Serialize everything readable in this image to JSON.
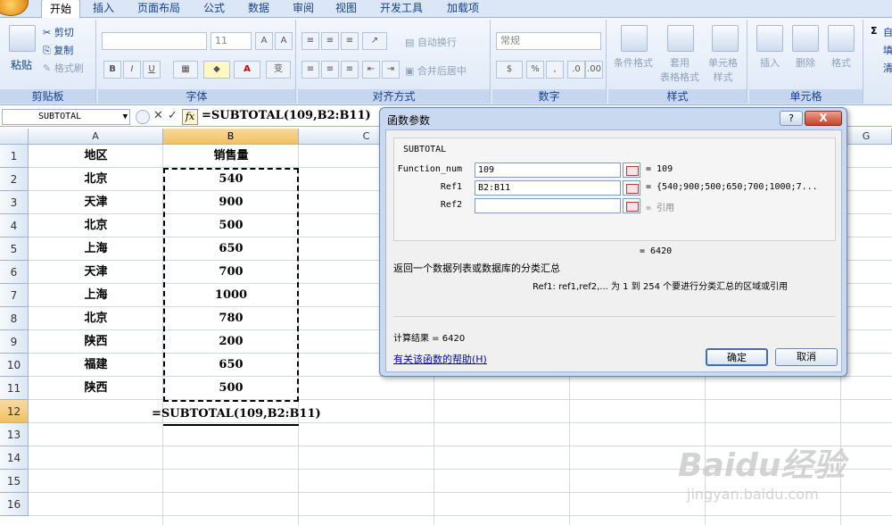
{
  "ribbon": {
    "tabs": [
      "开始",
      "插入",
      "页面布局",
      "公式",
      "数据",
      "审阅",
      "视图",
      "开发工具",
      "加载项"
    ],
    "clipboard": {
      "paste": "粘贴",
      "cut": "剪切",
      "copy": "复制",
      "format_painter": "格式刷",
      "label": "剪贴板"
    },
    "font": {
      "size": "11",
      "label": "字体",
      "bold": "B",
      "italic": "I",
      "underline": "U",
      "font_color": "A",
      "phonetic": "变"
    },
    "alignment": {
      "wrap": "自动换行",
      "merge": "合并后居中",
      "label": "对齐方式"
    },
    "number": {
      "format": "常规",
      "percent": "%",
      "comma": ",",
      "label": "数字"
    },
    "styles": {
      "conditional": "条件格式",
      "table": "套用\n表格格式",
      "cell": "单元格\n样式",
      "label": "样式"
    },
    "cells": {
      "insert": "插入",
      "delete": "删除",
      "format": "格式",
      "label": "单元格"
    },
    "editing": {
      "sum": "Σ",
      "item1": "自",
      "item2": "填",
      "item3": "清"
    }
  },
  "formula_bar": {
    "name_box": "SUBTOTAL",
    "fx": "fx",
    "formula": "=SUBTOTAL(109,B2:B11)"
  },
  "sheet": {
    "columns": [
      "A",
      "B",
      "C",
      "D",
      "E",
      "F",
      "G"
    ],
    "rows": [
      "1",
      "2",
      "3",
      "4",
      "5",
      "6",
      "7",
      "8",
      "9",
      "10",
      "11",
      "12",
      "13",
      "14",
      "15",
      "16"
    ],
    "header": {
      "a": "地区",
      "b": "销售量"
    },
    "data": [
      {
        "region": "北京",
        "sales": "540"
      },
      {
        "region": "天津",
        "sales": "900"
      },
      {
        "region": "北京",
        "sales": "500"
      },
      {
        "region": "上海",
        "sales": "650"
      },
      {
        "region": "天津",
        "sales": "700"
      },
      {
        "region": "上海",
        "sales": "1000"
      },
      {
        "region": "北京",
        "sales": "780"
      },
      {
        "region": "陕西",
        "sales": "200"
      },
      {
        "region": "福建",
        "sales": "650"
      },
      {
        "region": "陕西",
        "sales": "500"
      }
    ],
    "formula_cell": "=SUBTOTAL(109,B2:B11)"
  },
  "dialog": {
    "title": "函数参数",
    "help": "?",
    "close": "X",
    "function_name": "SUBTOTAL",
    "args": [
      {
        "label": "Function_num",
        "value": "109",
        "result": "= 109"
      },
      {
        "label": "Ref1",
        "value": "B2:B11",
        "result": "= {540;900;500;650;700;1000;7..."
      },
      {
        "label": "Ref2",
        "value": "",
        "result": "= 引用"
      }
    ],
    "total": "= 6420",
    "description": "返回一个数据列表或数据库的分类汇总",
    "arg_help": "Ref1:  ref1,ref2,...  为 1 到 254 个要进行分类汇总的区域或引用",
    "calc_result": "计算结果 =  6420",
    "help_link": "有关该函数的帮助(H)",
    "ok": "确定",
    "cancel": "取消"
  },
  "watermark": {
    "text": "Baidu经验",
    "url": "jingyan.baidu.com"
  }
}
